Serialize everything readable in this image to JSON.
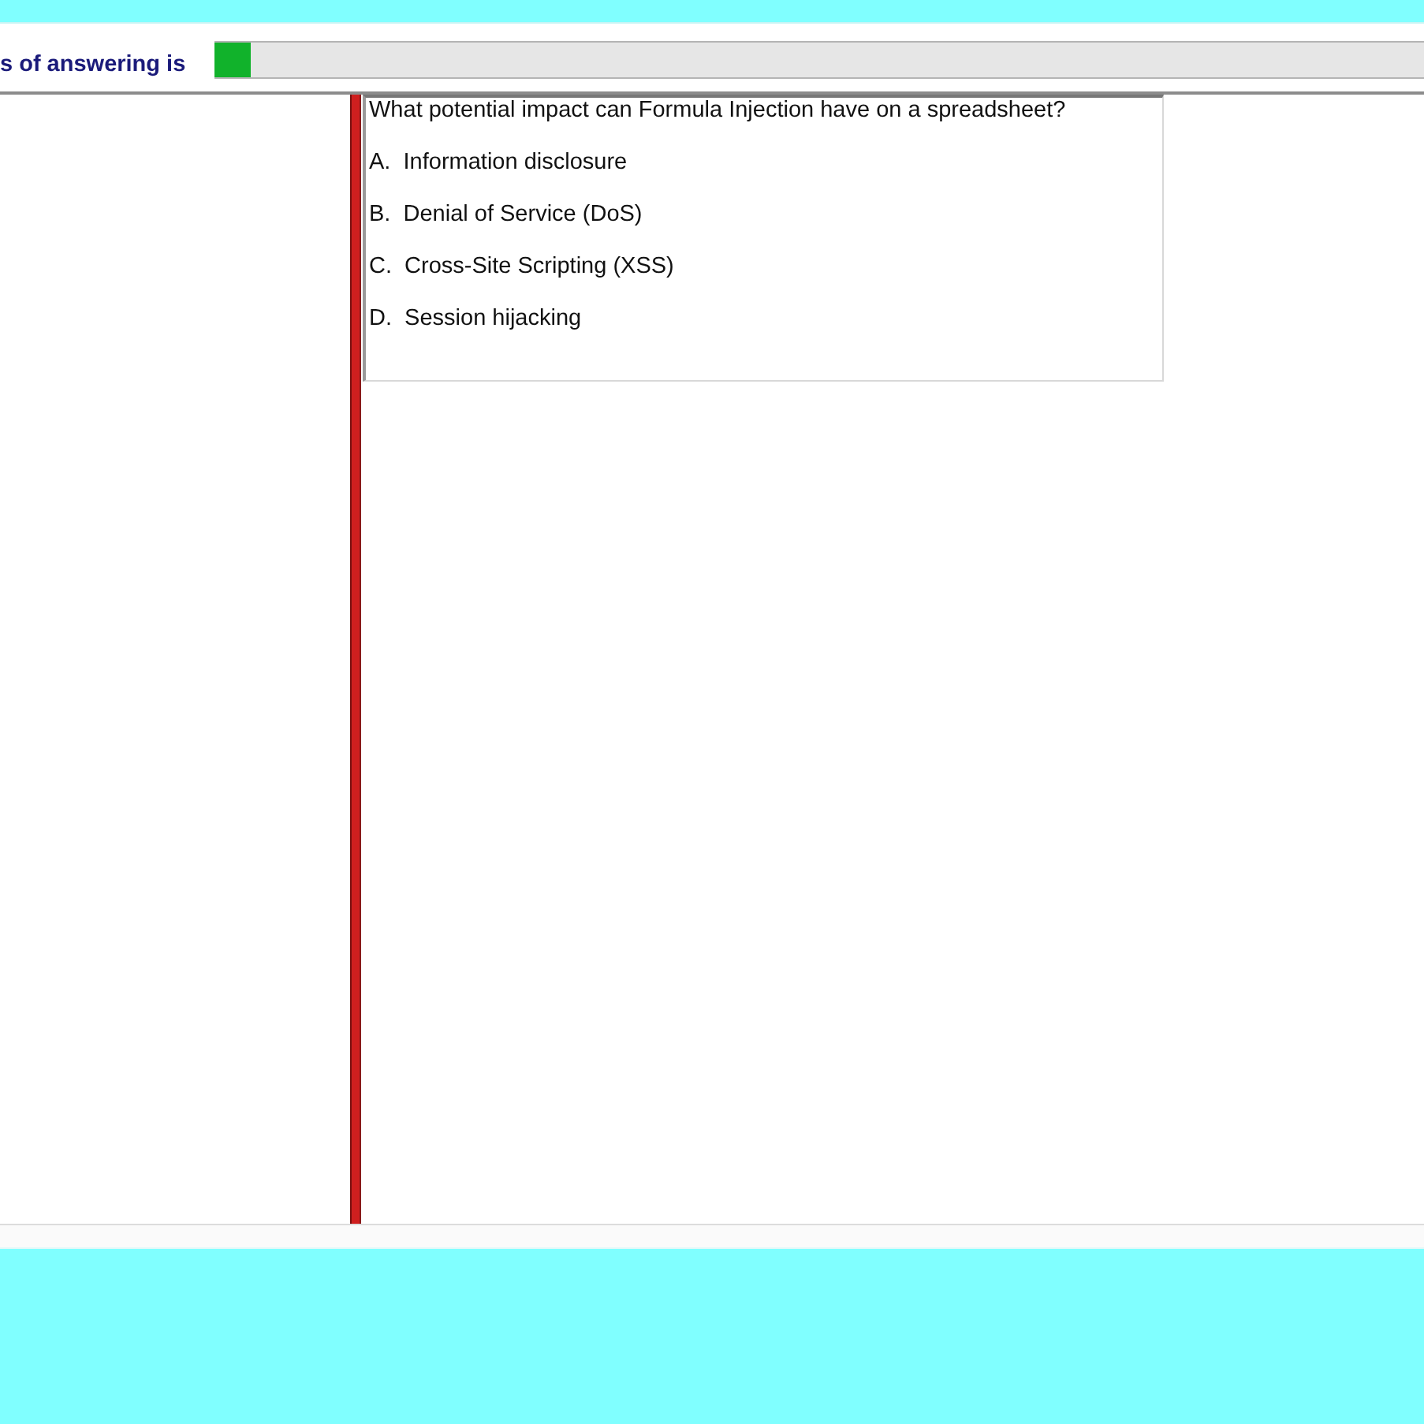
{
  "progress": {
    "label": "s of answering is",
    "level": 0.03
  },
  "question": {
    "text": "What potential impact can Formula Injection have on a spreadsheet?",
    "options": [
      "A.  Information disclosure",
      "B.  Denial of Service (DoS)",
      "C.  Cross-Site Scripting (XSS)",
      "D.  Session hijacking"
    ]
  }
}
